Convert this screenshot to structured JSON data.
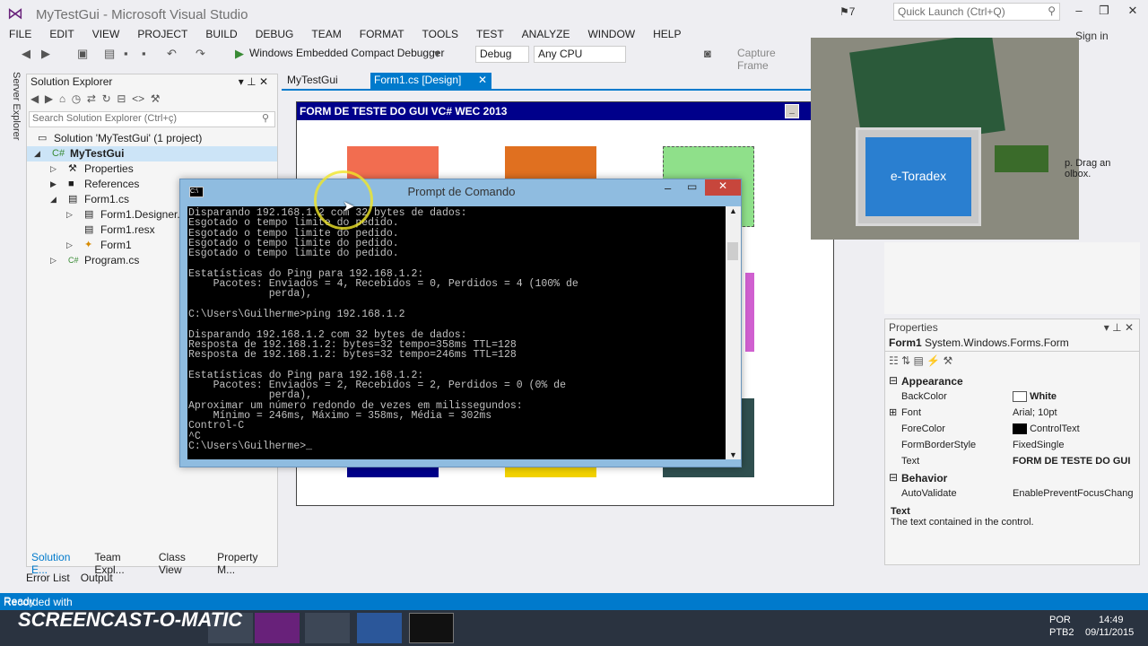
{
  "title": "MyTestGui - Microsoft Visual Studio",
  "notifications": "7",
  "quick_launch": "Quick Launch (Ctrl+Q)",
  "signin": "Sign in",
  "menu": [
    "FILE",
    "EDIT",
    "VIEW",
    "PROJECT",
    "BUILD",
    "DEBUG",
    "TEAM",
    "FORMAT",
    "TOOLS",
    "TEST",
    "ANALYZE",
    "WINDOW",
    "HELP"
  ],
  "toolbar": {
    "debugger": "Windows Embedded Compact Debugger",
    "config": "Debug",
    "platform": "Any CPU",
    "capture": "Capture Frame"
  },
  "side_tab": "Server Explorer",
  "solution_explorer": {
    "title": "Solution Explorer",
    "search": "Search Solution Explorer (Ctrl+ç)",
    "items": [
      {
        "label": "Solution 'MyTestGui' (1 project)"
      },
      {
        "label": "MyTestGui"
      },
      {
        "label": "Properties"
      },
      {
        "label": "References"
      },
      {
        "label": "Form1.cs"
      },
      {
        "label": "Form1.Designer.cs"
      },
      {
        "label": "Form1.resx"
      },
      {
        "label": "Form1"
      },
      {
        "label": "Program.cs"
      }
    ],
    "tabs": [
      "Solution E...",
      "Team Expl...",
      "Class View",
      "Property M..."
    ]
  },
  "bottom_tabs": [
    "Error List",
    "Output"
  ],
  "doc_tabs": [
    "MyTestGui",
    "Form1.cs [Design]"
  ],
  "form": {
    "title": "FORM DE TESTE DO GUI VC# WEC 2013",
    "panel_colors": [
      "#f26d50",
      "#e07020",
      "#8fe08a",
      "#d060d0",
      "#00008b",
      "#f2d200",
      "#2f4f4f"
    ]
  },
  "cmd": {
    "title": "Prompt de Comando",
    "lines": [
      "Disparando 192.168.1.2 com 32 bytes de dados:",
      "Esgotado o tempo limite do pedido.",
      "Esgotado o tempo limite do pedido.",
      "Esgotado o tempo limite do pedido.",
      "Esgotado o tempo limite do pedido.",
      "",
      "Estatísticas do Ping para 192.168.1.2:",
      "    Pacotes: Enviados = 4, Recebidos = 0, Perdidos = 4 (100% de",
      "             perda),",
      "",
      "C:\\Users\\Guilherme>ping 192.168.1.2",
      "",
      "Disparando 192.168.1.2 com 32 bytes de dados:",
      "Resposta de 192.168.1.2: bytes=32 tempo=358ms TTL=128",
      "Resposta de 192.168.1.2: bytes=32 tempo=246ms TTL=128",
      "",
      "Estatísticas do Ping para 192.168.1.2:",
      "    Pacotes: Enviados = 2, Recebidos = 2, Perdidos = 0 (0% de",
      "             perda),",
      "Aproximar um número redondo de vezes em milissegundos:",
      "    Mínimo = 246ms, Máximo = 358ms, Média = 302ms",
      "Control-C",
      "^C",
      "C:\\Users\\Guilherme>_"
    ]
  },
  "webcam_text": "e-Toradex",
  "right_pane_text": "p. Drag an olbox.",
  "properties": {
    "title": "Properties",
    "object": "Form1",
    "object_type": "System.Windows.Forms.Form",
    "categories": [
      {
        "name": "Appearance",
        "rows": [
          {
            "name": "BackColor",
            "value": "White"
          },
          {
            "name": "Font",
            "value": "Arial; 10pt"
          },
          {
            "name": "ForeColor",
            "value": "ControlText"
          },
          {
            "name": "FormBorderStyle",
            "value": "FixedSingle"
          },
          {
            "name": "Text",
            "value": "FORM DE TESTE DO GUI"
          }
        ]
      },
      {
        "name": "Behavior",
        "rows": [
          {
            "name": "AutoValidate",
            "value": "EnablePreventFocusChang"
          }
        ]
      }
    ],
    "desc_title": "Text",
    "desc_text": "The text contained in the control."
  },
  "status": "Ready",
  "screencast": {
    "line1": "Recorded with",
    "logo": "SCREENCAST-O-MATIC"
  },
  "tray": {
    "lang": "POR",
    "kbd": "PTB2",
    "time": "14:49",
    "date": "09/11/2015"
  },
  "colors": {
    "accent": "#007acc",
    "vs_purple": "#68217a",
    "cmd_frame": "#8fbce0"
  }
}
